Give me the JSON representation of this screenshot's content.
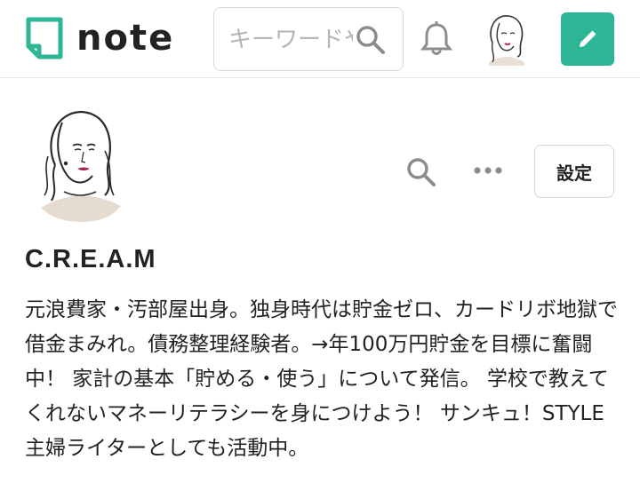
{
  "header": {
    "logo_text": "note",
    "search": {
      "placeholder": "キーワードや"
    },
    "icons": {
      "search": "search-icon",
      "bell": "bell-icon",
      "pencil": "pencil-icon"
    }
  },
  "profile": {
    "name": "C.R.E.A.M",
    "settings_label": "設定",
    "bio": "元浪費家・汚部屋出身。独身時代は貯金ゼロ、カードリボ地獄で借金まみれ。債務整理経験者。→年100万円貯金を目標に奮闘中！ 家計の基本「貯める・使う」について発信。 学校で教えてくれないマネーリテラシーを身につけよう！ サンキュ！STYLE主婦ライターとしても活動中。",
    "icons": {
      "search": "search-icon",
      "more": "more-dots-icon"
    }
  },
  "colors": {
    "accent": "#2cb696",
    "border": "#d7d7d7",
    "text": "#222222",
    "icon_gray": "#8c8c8c"
  }
}
